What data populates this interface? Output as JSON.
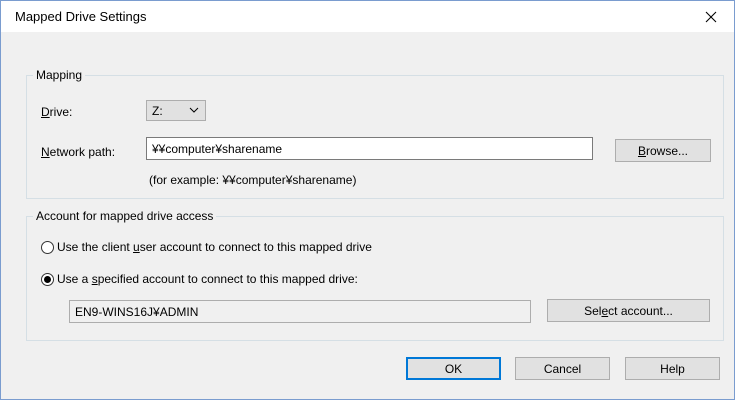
{
  "window": {
    "title": "Mapped Drive Settings",
    "close_glyph": "X"
  },
  "mapping": {
    "legend": "Mapping",
    "drive_label_pre": "",
    "drive_label_u": "D",
    "drive_label_post": "rive:",
    "drive_value": "Z:",
    "network_label_pre": "",
    "network_label_u": "N",
    "network_label_post": "etwork path:",
    "network_value": "¥¥computer¥sharename",
    "browse_pre": "",
    "browse_u": "B",
    "browse_post": "rowse...",
    "example": "(for example: ¥¥computer¥sharename)"
  },
  "account": {
    "legend": "Account for mapped drive access",
    "option1_pre": "Use the client ",
    "option1_u": "u",
    "option1_post": "ser account to connect to this mapped drive",
    "option1_checked": false,
    "option2_pre": "Use a ",
    "option2_u": "s",
    "option2_post": "pecified account to connect to this mapped drive:",
    "option2_checked": true,
    "account_value": "EN9-WINS16J¥ADMIN",
    "select_pre": "Sel",
    "select_u": "e",
    "select_post": "ct account..."
  },
  "footer": {
    "ok": "OK",
    "cancel": "Cancel",
    "help": "Help"
  }
}
